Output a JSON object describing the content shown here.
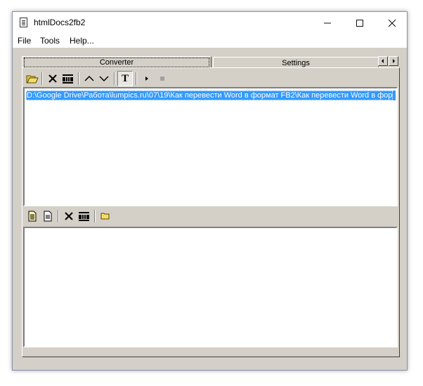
{
  "window": {
    "title": "htmlDocs2fb2",
    "controls": {
      "minimize": "—",
      "maximize": "☐",
      "close": "✕"
    }
  },
  "menu": {
    "file": "File",
    "tools": "Tools",
    "help": "Help..."
  },
  "tabs": {
    "converter": "Converter",
    "settings": "Settings",
    "scroll_left": "◀",
    "scroll_right": "▶"
  },
  "toolbar1": {
    "icons": [
      "open-folder-icon",
      "delete-icon",
      "clear-list-icon",
      "move-up-icon",
      "move-down-icon",
      "text-format-icon",
      "play-icon",
      "stop-icon"
    ],
    "text_button": "T"
  },
  "toolbar2": {
    "icons": [
      "document-properties-icon",
      "document-icon",
      "delete-icon",
      "clear-list-icon",
      "folder-icon"
    ]
  },
  "files_list": {
    "items": [
      "D:\\Google Drive\\Работа\\lumpics.ru\\07\\19\\Как перевести Word в формат FB2\\Как перевести Word в фор"
    ]
  },
  "colors": {
    "selection": "#3399ff",
    "window_bg": "#d4d0c8"
  }
}
